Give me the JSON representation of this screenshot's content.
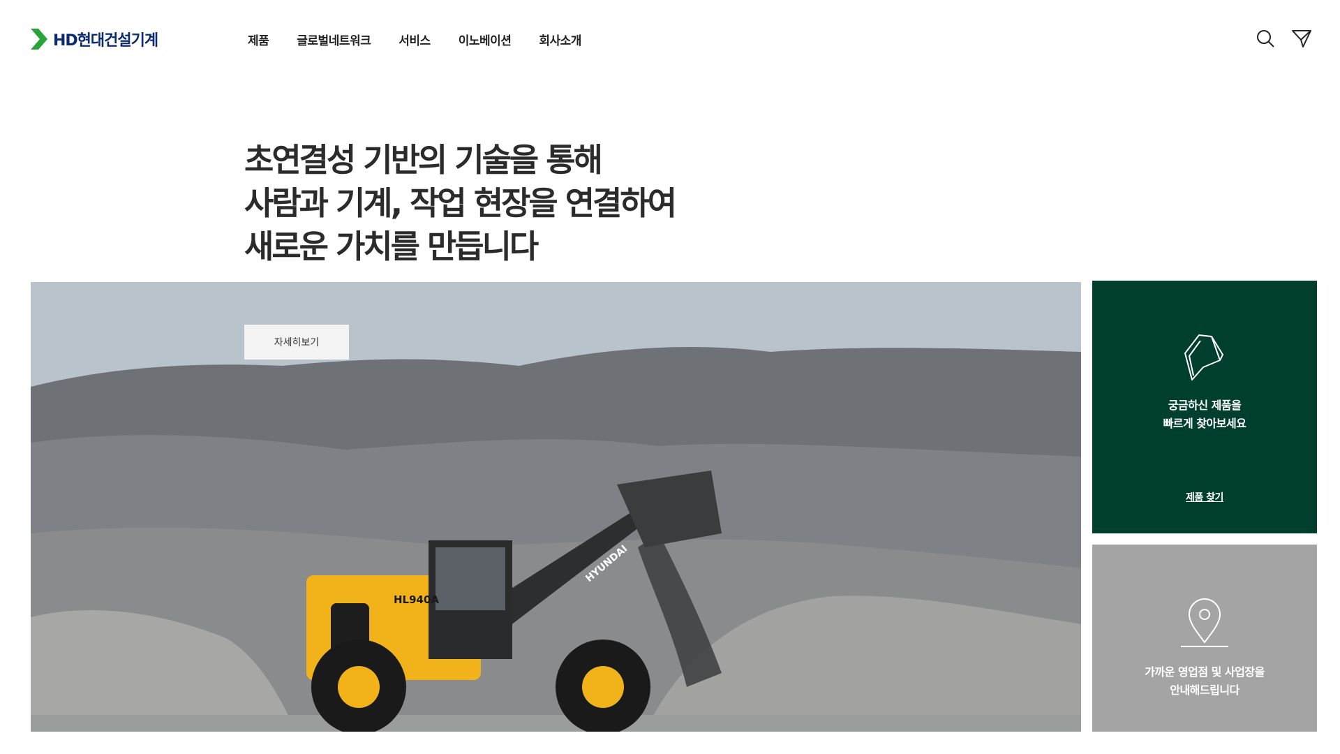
{
  "header": {
    "logo_text": "HD현대건설기계",
    "nav": [
      "제품",
      "글로벌네트워크",
      "서비스",
      "이노베이션",
      "회사소개"
    ],
    "icons": [
      "search-icon",
      "send-icon"
    ]
  },
  "hero": {
    "headline": [
      "초연결성 기반의 기술을 통해",
      "사람과 기계, 작업 현장을 연결하여",
      "새로운 가치를 만듭니다"
    ],
    "more_label": "자세히보기",
    "machine_model": "HL940A",
    "machine_brand": "HYUNDAI"
  },
  "cards": {
    "product": {
      "icon": "bucket-icon",
      "text": [
        "궁금하신 제품을",
        "빠르게 찾아보세요"
      ],
      "link": "제품 찾기",
      "color": "#003f2d"
    },
    "location": {
      "icon": "map-pin-icon",
      "text": [
        "가까운 영업점 및 사업장을",
        "안내해드립니다"
      ],
      "color": "#a3a4a3"
    }
  },
  "colors": {
    "brand_green": "#2aa33a",
    "brand_navy": "#0b2a6f"
  }
}
